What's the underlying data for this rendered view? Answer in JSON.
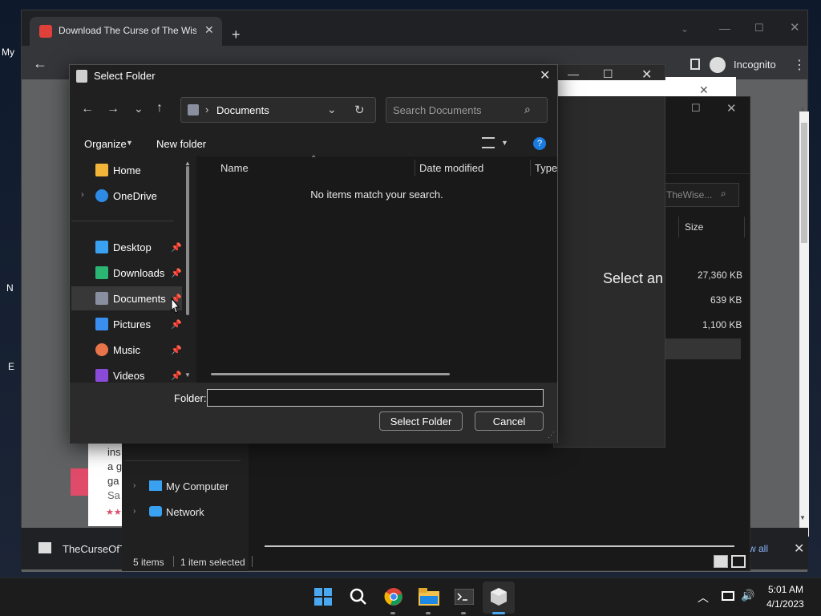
{
  "desktop": {
    "label_my": "My",
    "label_n": "N",
    "label_e": "E"
  },
  "chrome": {
    "tab_title": "Download The Curse of The Wise",
    "incognito_label": "Incognito",
    "download_file": "TheCurseOfT",
    "show_all": "w all"
  },
  "explorer": {
    "search_text": "TheWise...",
    "size_header": "Size",
    "center_text": "Select an",
    "sizes": [
      "27,360 KB",
      "639 KB",
      "1,100 KB"
    ],
    "nav_items": [
      "My Computer",
      "Network"
    ],
    "status_items": "5 items",
    "status_selected": "1 item selected"
  },
  "page_fragments": [
    "ins",
    "a g",
    "ga",
    "Sa"
  ],
  "dialog": {
    "title": "Select Folder",
    "address_current": "Documents",
    "search_placeholder": "Search Documents",
    "organize_label": "Organize",
    "new_folder_label": "New folder",
    "nav": [
      {
        "label": "Home",
        "icon": "home-icon",
        "color": "#f2b53a"
      },
      {
        "label": "OneDrive",
        "icon": "onedrive-icon",
        "color": "#2d8be6"
      },
      {
        "label": "Desktop",
        "icon": "desktop-icon",
        "color": "#3aa0f0"
      },
      {
        "label": "Downloads",
        "icon": "download-icon",
        "color": "#2bb673"
      },
      {
        "label": "Documents",
        "icon": "documents-icon",
        "color": "#8a8fa0"
      },
      {
        "label": "Pictures",
        "icon": "pictures-icon",
        "color": "#3a8ef0"
      },
      {
        "label": "Music",
        "icon": "music-icon",
        "color": "#e8744a"
      },
      {
        "label": "Videos",
        "icon": "videos-icon",
        "color": "#8a4ad8"
      }
    ],
    "columns": {
      "name": "Name",
      "date_modified": "Date modified",
      "type": "Type"
    },
    "empty_message": "No items match your search.",
    "folder_label": "Folder:",
    "folder_value": "",
    "select_button": "Select Folder",
    "cancel_button": "Cancel"
  },
  "taskbar": {
    "time": "5:01 AM",
    "date": "4/1/2023"
  }
}
